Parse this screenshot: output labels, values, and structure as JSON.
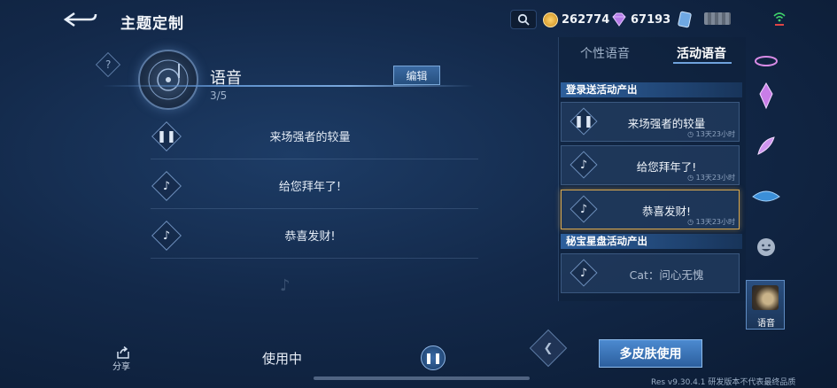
{
  "header": {
    "title": "主题定制",
    "currencies": [
      {
        "name": "gold-coin",
        "value": "262774",
        "color": "#e9b14a"
      },
      {
        "name": "diamond",
        "value": "67193",
        "color": "#b57be8"
      }
    ]
  },
  "voice_section": {
    "help": "?",
    "title": "语音",
    "count": "3/5",
    "edit_label": "编辑",
    "items": [
      {
        "label": "来场强者的较量",
        "icon": "pause-icon"
      },
      {
        "label": "给您拜年了!",
        "icon": "music-note-icon"
      },
      {
        "label": "恭喜发财!",
        "icon": "music-note-icon"
      }
    ]
  },
  "bottom": {
    "share_label": "分享",
    "status_label": "使用中"
  },
  "right_panel": {
    "tabs": [
      {
        "label": "个性语音",
        "active": false
      },
      {
        "label": "活动语音",
        "active": true
      }
    ],
    "groups": [
      {
        "title": "登录送活动产出",
        "cards": [
          {
            "label": "来场强者的较量",
            "icon": "pause-icon",
            "timer": "13天23小时"
          },
          {
            "label": "给您拜年了!",
            "icon": "music-note-icon",
            "timer": "13天23小时"
          },
          {
            "label": "恭喜发财!",
            "icon": "music-note-icon",
            "timer": "13天23小时",
            "selected": true
          }
        ]
      },
      {
        "title": "秘宝星盘活动产出",
        "cards": [
          {
            "label": "Cat：问心无愧",
            "icon": "music-note-icon",
            "dim": true
          }
        ]
      }
    ],
    "multi_skin_label": "多皮肤使用"
  },
  "side_strip": {
    "active_label": "语音"
  },
  "footer": {
    "version": "Res v9.30.4.1 研发版本不代表最终品质"
  },
  "colors": {
    "accent": "#4c8ad0",
    "selected_border": "#d8a850",
    "background": "#13294a"
  }
}
